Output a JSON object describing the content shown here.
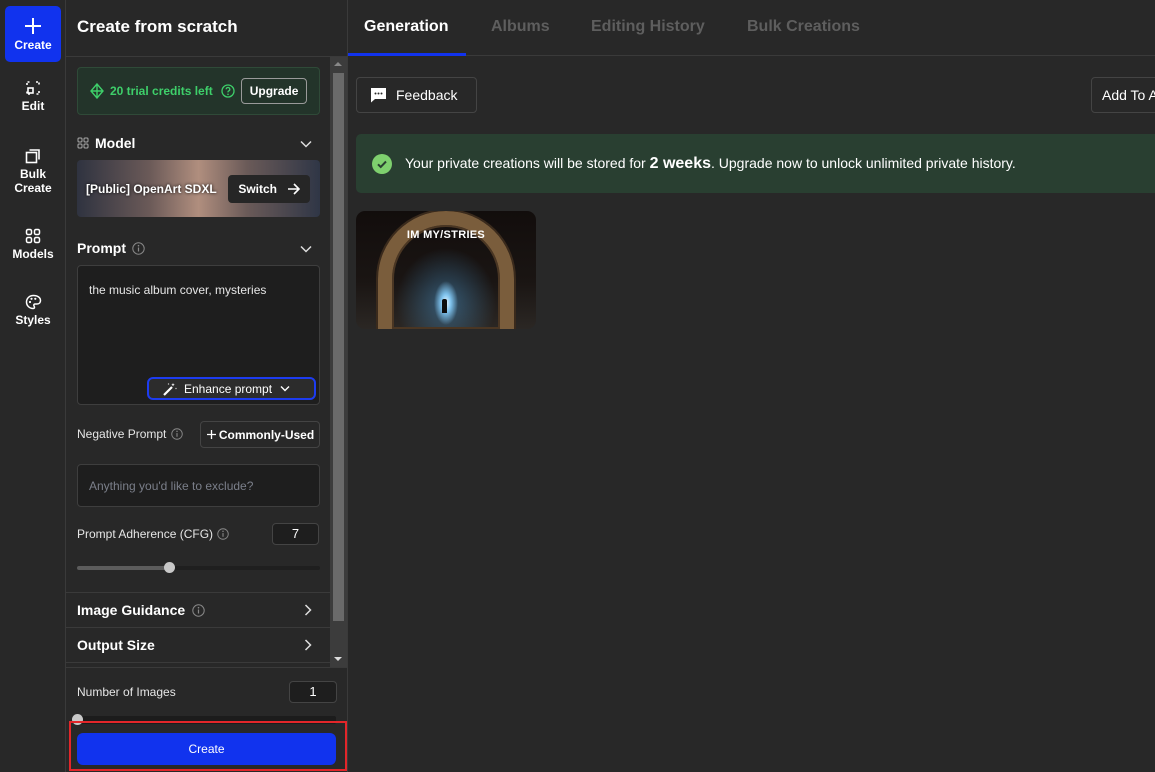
{
  "nav": {
    "items": [
      {
        "label": "Create",
        "icon": "plus-icon",
        "active": true
      },
      {
        "label": "Edit",
        "icon": "edit-crop-icon"
      },
      {
        "label": "Bulk",
        "label2": "Create",
        "icon": "copy-stack-icon"
      },
      {
        "label": "Models",
        "icon": "grid-icon"
      },
      {
        "label": "Styles",
        "icon": "palette-icon"
      }
    ]
  },
  "panel": {
    "title": "Create from scratch",
    "credits": {
      "text": "20 trial credits left",
      "upgrade_label": "Upgrade",
      "color": "#3ecf6a"
    },
    "model": {
      "title": "Model",
      "name": "[Public] OpenArt SDXL",
      "switch_label": "Switch"
    },
    "prompt": {
      "title": "Prompt",
      "value": "the music album cover, mysteries",
      "enhance_label": "Enhance prompt"
    },
    "negative_prompt": {
      "label": "Negative Prompt",
      "commonly_used_label": "Commonly-Used",
      "placeholder": "Anything you'd like to exclude?",
      "value": ""
    },
    "cfg": {
      "label": "Prompt Adherence (CFG)",
      "value": "7",
      "slider_fraction": 0.38
    },
    "image_guidance": {
      "label": "Image Guidance"
    },
    "output_size": {
      "label": "Output Size"
    },
    "num_images": {
      "label": "Number of Images",
      "value": "1",
      "slider_fraction": 0.0
    },
    "create_label": "Create"
  },
  "main": {
    "tabs": [
      {
        "label": "Generation",
        "active": true
      },
      {
        "label": "Albums"
      },
      {
        "label": "Editing History"
      },
      {
        "label": "Bulk Creations"
      }
    ],
    "feedback_label": "Feedback",
    "add_to_label": "Add To A",
    "banner": {
      "prefix": "Your private creations will be stored for ",
      "bold": "2 weeks",
      "suffix": ". Upgrade now to unlock unlimited private history."
    },
    "images": [
      {
        "title": "IM MY/STRIES"
      }
    ]
  },
  "colors": {
    "accent": "#1133ee",
    "highlight_frame": "#e3262a",
    "banner_bg": "#293f31"
  }
}
